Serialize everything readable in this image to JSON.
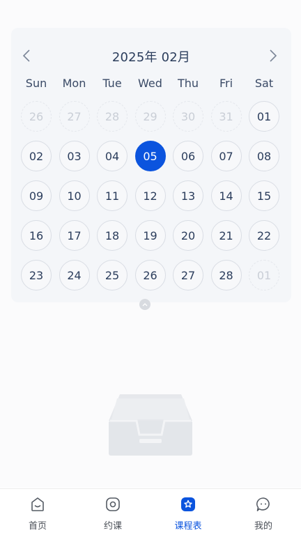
{
  "calendar": {
    "title": "2025年 02月",
    "weekdays": [
      "Sun",
      "Mon",
      "Tue",
      "Wed",
      "Thu",
      "Fri",
      "Sat"
    ],
    "selected_day": "05",
    "accent_color": "#0b54de",
    "weeks": [
      [
        {
          "d": "26",
          "muted": true
        },
        {
          "d": "27",
          "muted": true
        },
        {
          "d": "28",
          "muted": true
        },
        {
          "d": "29",
          "muted": true
        },
        {
          "d": "30",
          "muted": true
        },
        {
          "d": "31",
          "muted": true
        },
        {
          "d": "01"
        }
      ],
      [
        {
          "d": "02"
        },
        {
          "d": "03"
        },
        {
          "d": "04"
        },
        {
          "d": "05",
          "selected": true
        },
        {
          "d": "06"
        },
        {
          "d": "07"
        },
        {
          "d": "08"
        }
      ],
      [
        {
          "d": "09"
        },
        {
          "d": "10"
        },
        {
          "d": "11"
        },
        {
          "d": "12"
        },
        {
          "d": "13"
        },
        {
          "d": "14"
        },
        {
          "d": "15"
        }
      ],
      [
        {
          "d": "16"
        },
        {
          "d": "17"
        },
        {
          "d": "18"
        },
        {
          "d": "19"
        },
        {
          "d": "20"
        },
        {
          "d": "21"
        },
        {
          "d": "22"
        }
      ],
      [
        {
          "d": "23"
        },
        {
          "d": "24"
        },
        {
          "d": "25"
        },
        {
          "d": "26"
        },
        {
          "d": "27"
        },
        {
          "d": "28"
        },
        {
          "d": "01",
          "muted": true
        }
      ]
    ]
  },
  "tabbar": {
    "items": [
      {
        "label": "首页",
        "icon": "home-icon"
      },
      {
        "label": "约课",
        "icon": "booking-icon"
      },
      {
        "label": "课程表",
        "icon": "schedule-icon",
        "active": true
      },
      {
        "label": "我的",
        "icon": "profile-icon"
      }
    ]
  }
}
